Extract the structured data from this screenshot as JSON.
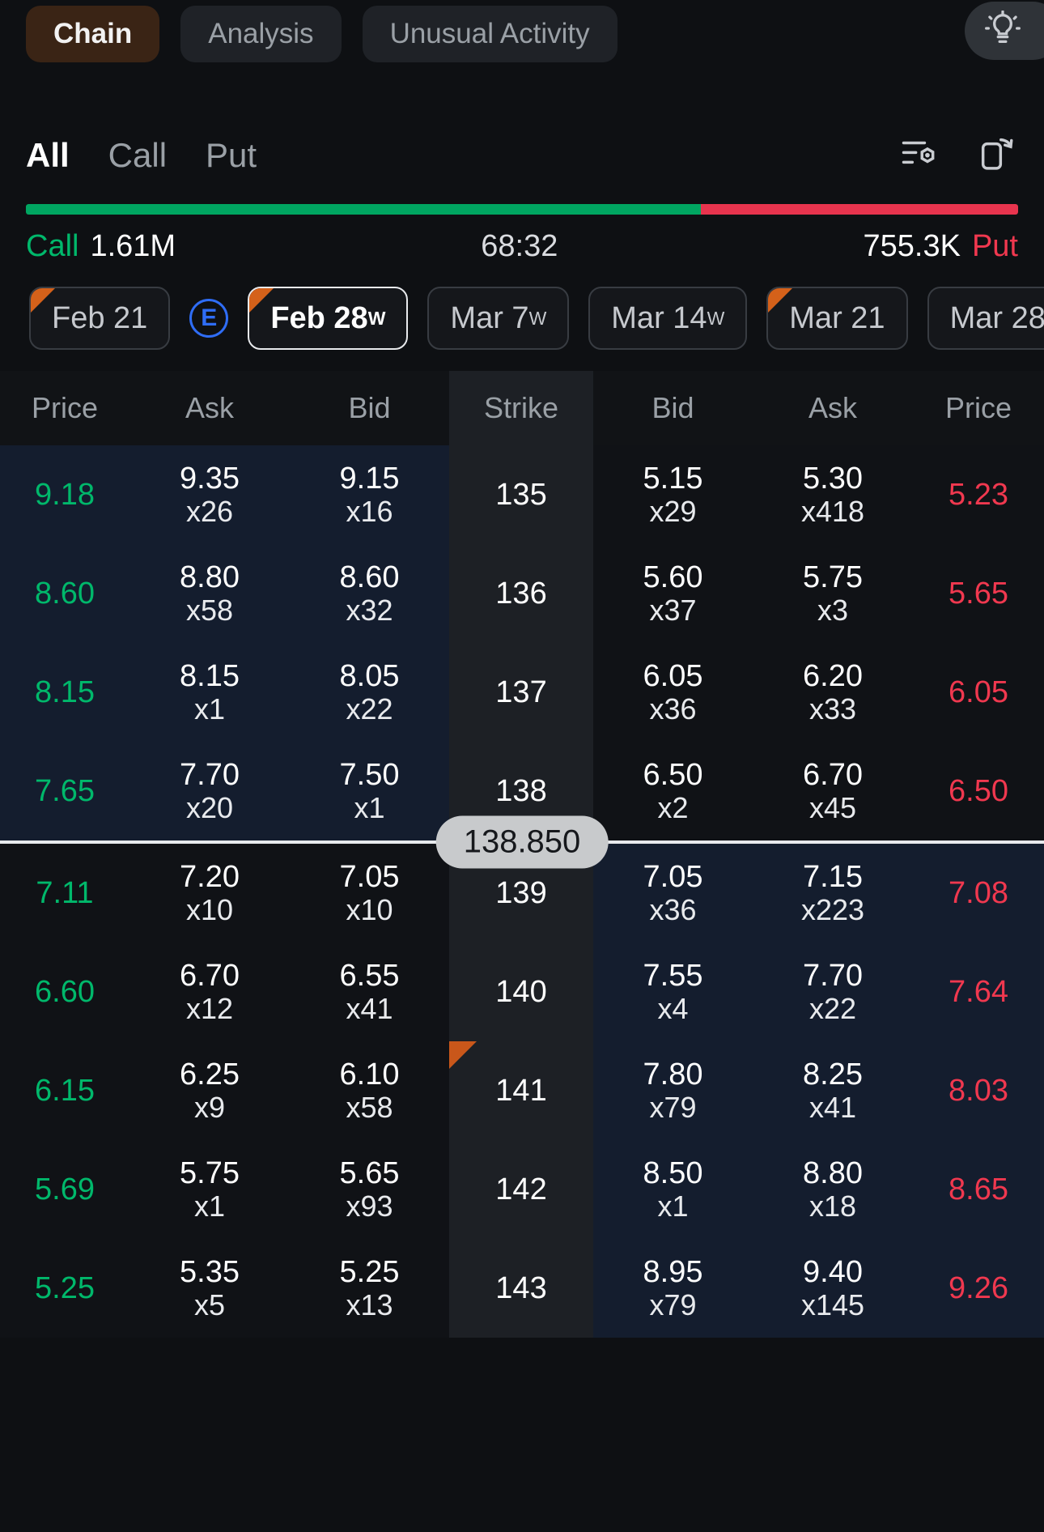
{
  "topbar": {
    "tabs": [
      {
        "label": "Chain",
        "active": true
      },
      {
        "label": "Analysis",
        "active": false
      },
      {
        "label": "Unusual Activity",
        "active": false
      }
    ],
    "bulb_icon": "lightbulb-icon"
  },
  "filter": {
    "segments": [
      {
        "label": "All",
        "active": true
      },
      {
        "label": "Call",
        "active": false
      },
      {
        "label": "Put",
        "active": false
      }
    ],
    "settings_icon": "list-settings-icon",
    "rotate_icon": "rotate-screen-icon"
  },
  "ratio": {
    "call_label": "Call",
    "call_value": "1.61M",
    "middle": "68:32",
    "put_value": "755.3K",
    "put_label": "Put",
    "call_pct": 68,
    "put_pct": 32,
    "call_color": "#00a661",
    "put_color": "#e8344e"
  },
  "expiries": [
    {
      "date": "Feb 21",
      "weekly": false,
      "selected": false,
      "marker": true
    },
    {
      "date": "Feb 28",
      "weekly": true,
      "selected": true,
      "marker": true
    },
    {
      "date": "Mar 7",
      "weekly": true,
      "selected": false,
      "marker": false
    },
    {
      "date": "Mar 14",
      "weekly": true,
      "selected": false,
      "marker": false
    },
    {
      "date": "Mar 21",
      "weekly": false,
      "selected": false,
      "marker": true
    },
    {
      "date": "Mar 28",
      "weekly": true,
      "selected": false,
      "marker": false
    }
  ],
  "expiry_badge": "E",
  "table": {
    "headers": [
      "Price",
      "Ask",
      "Bid",
      "Strike",
      "Bid",
      "Ask",
      "Price"
    ],
    "underlying_price": "138.850",
    "rows": [
      {
        "call_price": "9.18",
        "call_ask": "9.35",
        "call_ask_qty": "x26",
        "call_bid": "9.15",
        "call_bid_qty": "x16",
        "strike": "135",
        "put_bid": "5.15",
        "put_bid_qty": "x29",
        "put_ask": "5.30",
        "put_ask_qty": "x418",
        "put_price": "5.23",
        "call_itm": true,
        "put_itm": false,
        "strike_marker": false
      },
      {
        "call_price": "8.60",
        "call_ask": "8.80",
        "call_ask_qty": "x58",
        "call_bid": "8.60",
        "call_bid_qty": "x32",
        "strike": "136",
        "put_bid": "5.60",
        "put_bid_qty": "x37",
        "put_ask": "5.75",
        "put_ask_qty": "x3",
        "put_price": "5.65",
        "call_itm": true,
        "put_itm": false,
        "strike_marker": false
      },
      {
        "call_price": "8.15",
        "call_ask": "8.15",
        "call_ask_qty": "x1",
        "call_bid": "8.05",
        "call_bid_qty": "x22",
        "strike": "137",
        "put_bid": "6.05",
        "put_bid_qty": "x36",
        "put_ask": "6.20",
        "put_ask_qty": "x33",
        "put_price": "6.05",
        "call_itm": true,
        "put_itm": false,
        "strike_marker": false
      },
      {
        "call_price": "7.65",
        "call_ask": "7.70",
        "call_ask_qty": "x20",
        "call_bid": "7.50",
        "call_bid_qty": "x1",
        "strike": "138",
        "put_bid": "6.50",
        "put_bid_qty": "x2",
        "put_ask": "6.70",
        "put_ask_qty": "x45",
        "put_price": "6.50",
        "call_itm": true,
        "put_itm": false,
        "strike_marker": false
      },
      {
        "call_price": "7.11",
        "call_ask": "7.20",
        "call_ask_qty": "x10",
        "call_bid": "7.05",
        "call_bid_qty": "x10",
        "strike": "139",
        "put_bid": "7.05",
        "put_bid_qty": "x36",
        "put_ask": "7.15",
        "put_ask_qty": "x223",
        "put_price": "7.08",
        "call_itm": false,
        "put_itm": true,
        "strike_marker": false
      },
      {
        "call_price": "6.60",
        "call_ask": "6.70",
        "call_ask_qty": "x12",
        "call_bid": "6.55",
        "call_bid_qty": "x41",
        "strike": "140",
        "put_bid": "7.55",
        "put_bid_qty": "x4",
        "put_ask": "7.70",
        "put_ask_qty": "x22",
        "put_price": "7.64",
        "call_itm": false,
        "put_itm": true,
        "strike_marker": false
      },
      {
        "call_price": "6.15",
        "call_ask": "6.25",
        "call_ask_qty": "x9",
        "call_bid": "6.10",
        "call_bid_qty": "x58",
        "strike": "141",
        "put_bid": "7.80",
        "put_bid_qty": "x79",
        "put_ask": "8.25",
        "put_ask_qty": "x41",
        "put_price": "8.03",
        "call_itm": false,
        "put_itm": true,
        "strike_marker": true
      },
      {
        "call_price": "5.69",
        "call_ask": "5.75",
        "call_ask_qty": "x1",
        "call_bid": "5.65",
        "call_bid_qty": "x93",
        "strike": "142",
        "put_bid": "8.50",
        "put_bid_qty": "x1",
        "put_ask": "8.80",
        "put_ask_qty": "x18",
        "put_price": "8.65",
        "call_itm": false,
        "put_itm": true,
        "strike_marker": false
      },
      {
        "call_price": "5.25",
        "call_ask": "5.35",
        "call_ask_qty": "x5",
        "call_bid": "5.25",
        "call_bid_qty": "x13",
        "strike": "143",
        "put_bid": "8.95",
        "put_bid_qty": "x79",
        "put_ask": "9.40",
        "put_ask_qty": "x145",
        "put_price": "9.26",
        "call_itm": false,
        "put_itm": true,
        "strike_marker": false
      }
    ],
    "divider_after_row_index": 3
  }
}
